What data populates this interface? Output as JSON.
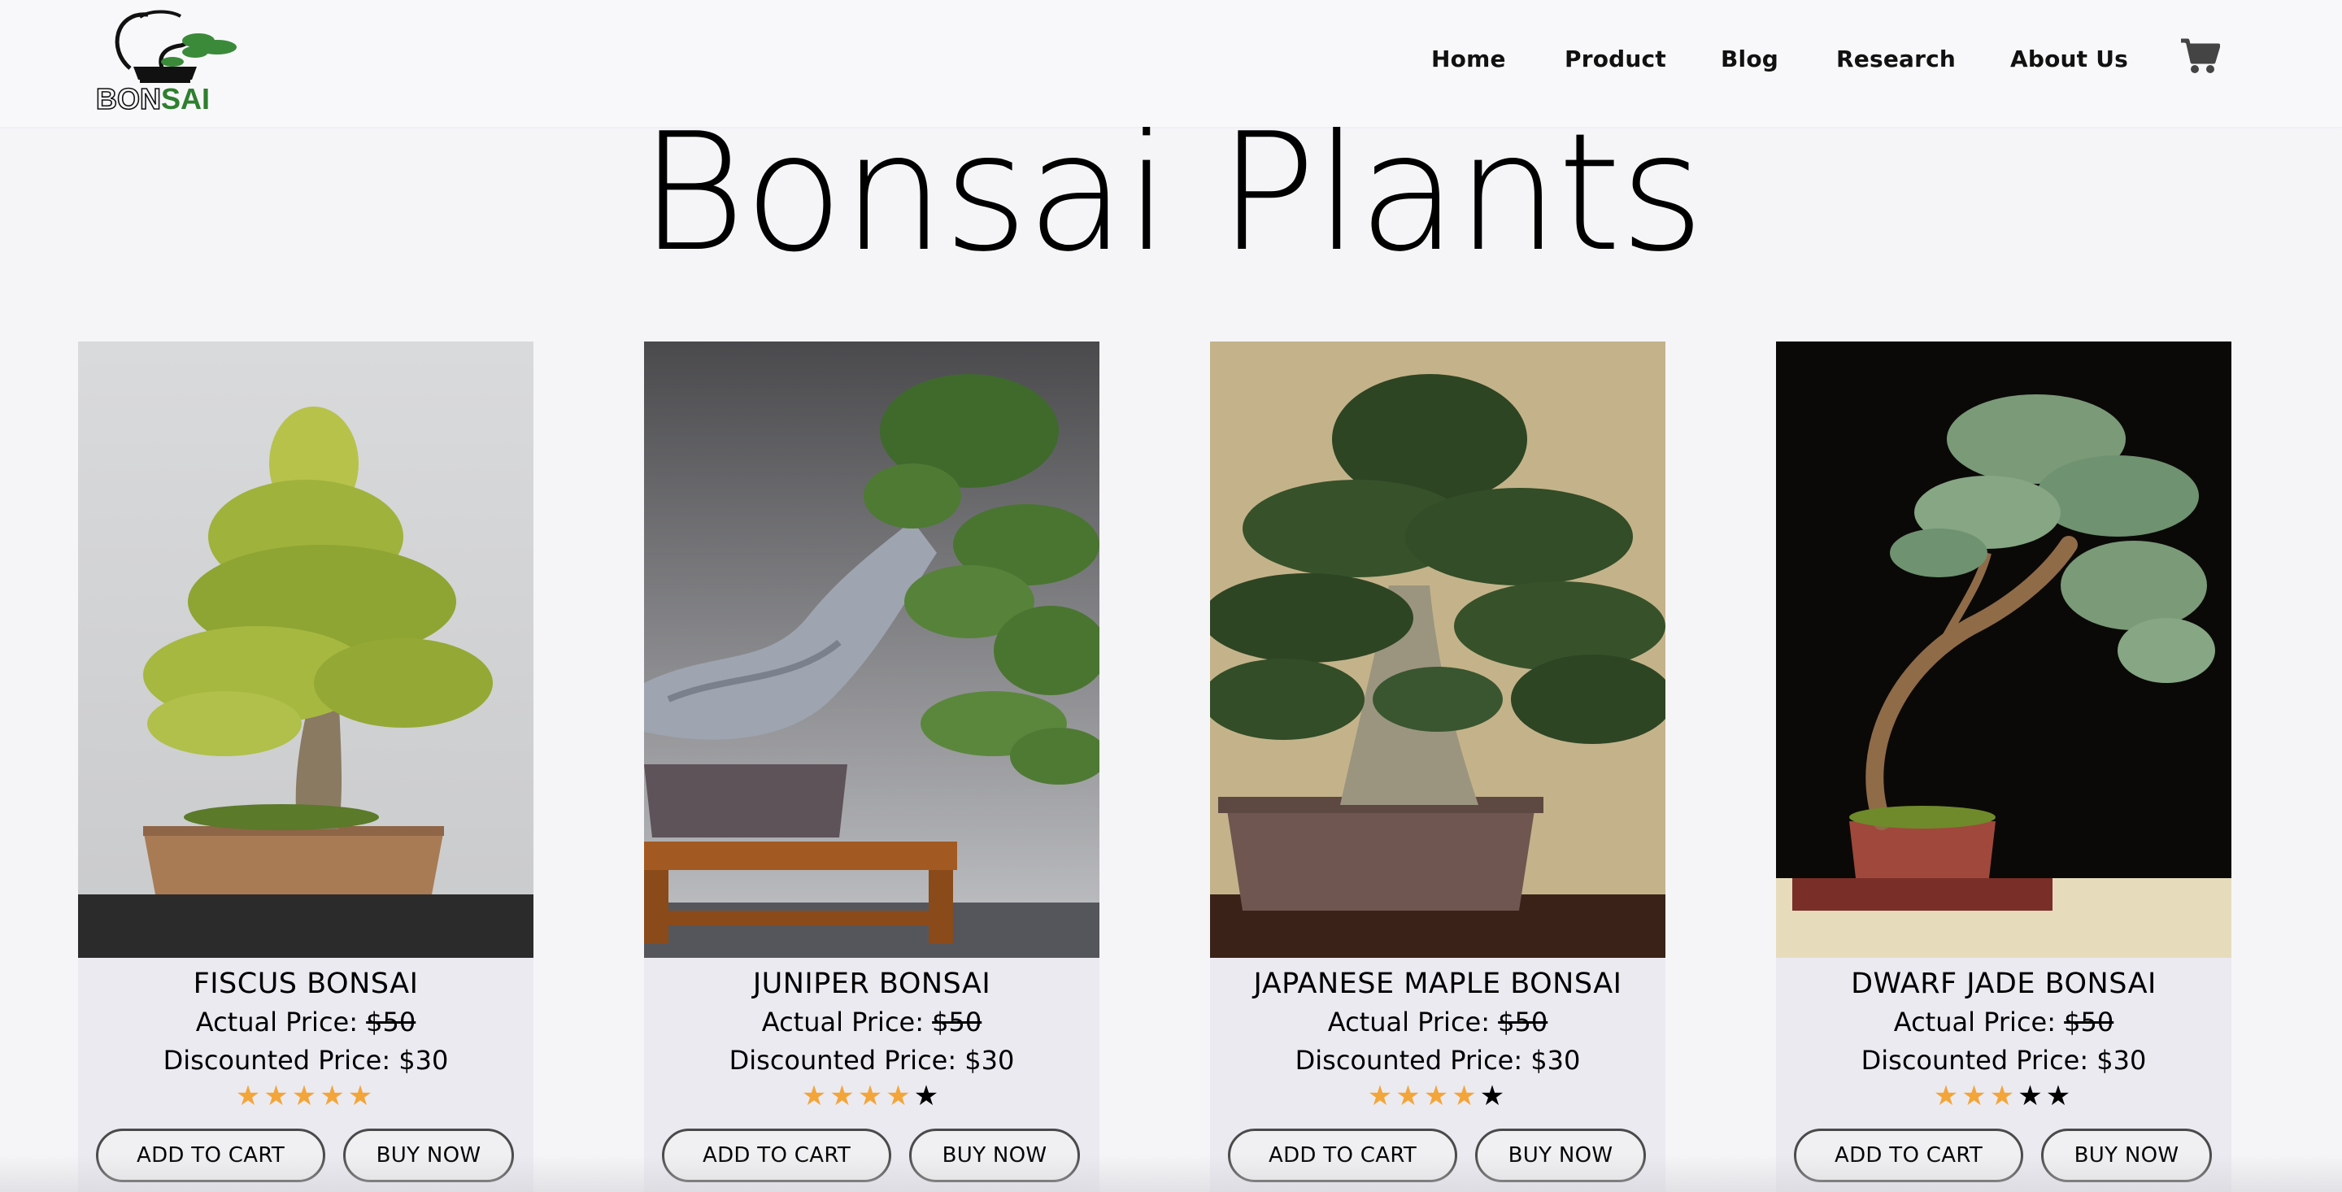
{
  "header": {
    "logo_text_gray": "BON",
    "logo_text_green": "SAI",
    "nav": [
      {
        "label": "Home"
      },
      {
        "label": "Product"
      },
      {
        "label": "Blog"
      },
      {
        "label": "Research"
      },
      {
        "label": "About Us"
      }
    ],
    "cart_icon": "shopping-cart-icon"
  },
  "main": {
    "title": "Bonsai Plants",
    "products": [
      {
        "name": "FISCUS BONSAI",
        "actual_price_label": "Actual Price:",
        "actual_price": "$50",
        "discounted_price_label": "Discounted Price: $30",
        "rating": 5,
        "rating_max": 5,
        "add_to_cart_label": "ADD TO CART",
        "buy_now_label": "BUY NOW"
      },
      {
        "name": "JUNIPER BONSAI",
        "actual_price_label": "Actual Price:",
        "actual_price": "$50",
        "discounted_price_label": "Discounted Price: $30",
        "rating": 4,
        "rating_max": 5,
        "add_to_cart_label": "ADD TO CART",
        "buy_now_label": "BUY NOW"
      },
      {
        "name": "JAPANESE MAPLE BONSAI",
        "actual_price_label": "Actual Price:",
        "actual_price": "$50",
        "discounted_price_label": "Discounted Price: $30",
        "rating": 4,
        "rating_max": 5,
        "add_to_cart_label": "ADD TO CART",
        "buy_now_label": "BUY NOW"
      },
      {
        "name": "DWARF JADE BONSAI",
        "actual_price_label": "Actual Price:",
        "actual_price": "$50",
        "discounted_price_label": "Discounted Price: $30",
        "rating": 3,
        "rating_max": 5,
        "add_to_cart_label": "ADD TO CART",
        "buy_now_label": "BUY NOW"
      }
    ]
  },
  "colors": {
    "star_on": "#f3a53a",
    "star_off": "#000000",
    "brand_green": "#3a8a3a",
    "card_bg": "#ebeaf1"
  }
}
